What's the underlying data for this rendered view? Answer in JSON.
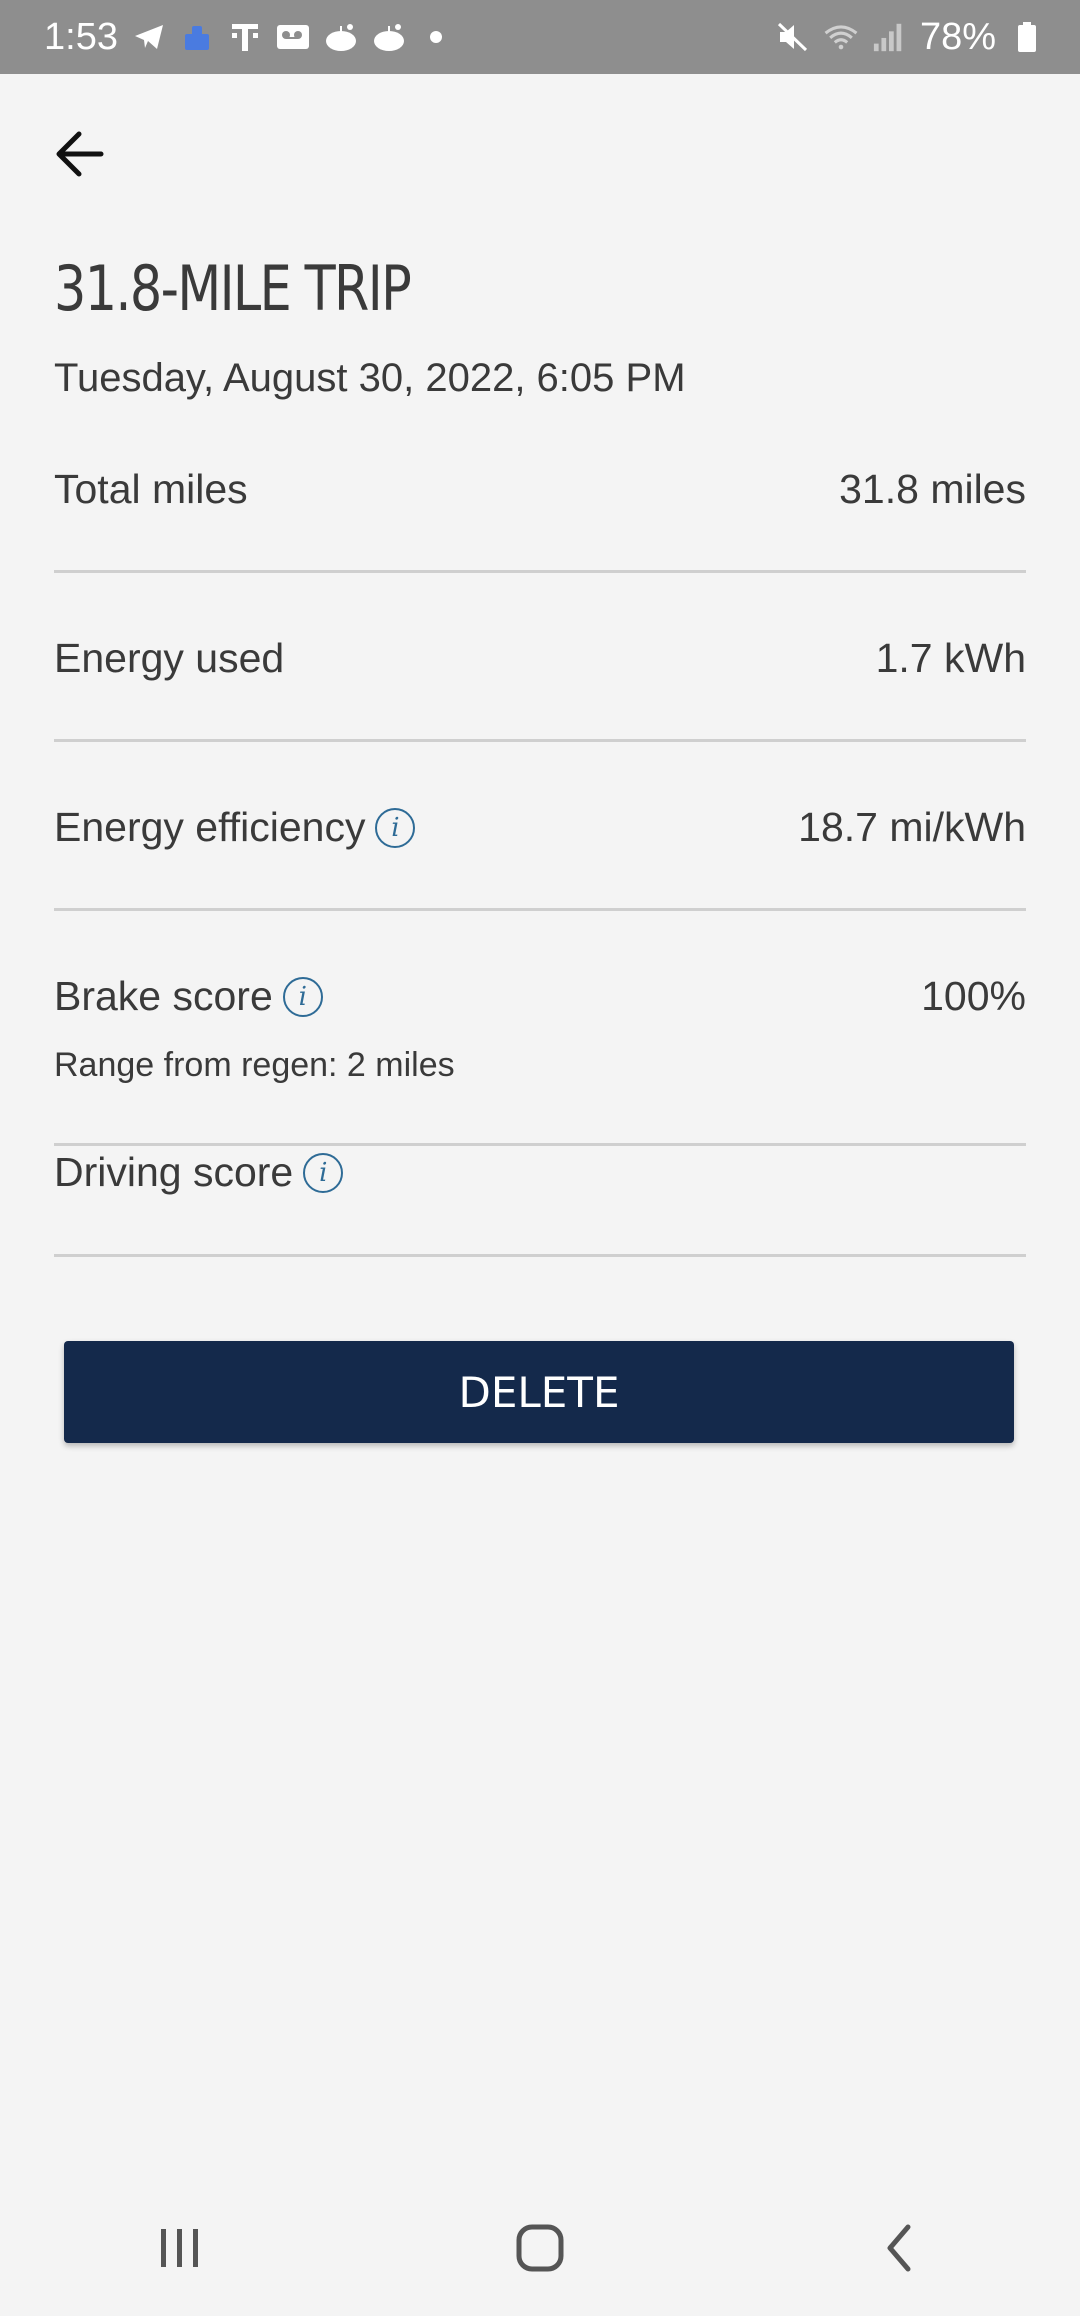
{
  "status_bar": {
    "time": "1:53",
    "battery": "78%",
    "left_icons": [
      "telegram-icon",
      "app-icon",
      "tmobile-icon",
      "voicemail-icon",
      "reddit-icon",
      "reddit-icon"
    ],
    "right_icons": [
      "mute-icon",
      "wifi-icon",
      "signal-icon",
      "battery-icon"
    ]
  },
  "header": {
    "title": "31.8-MILE TRIP",
    "date": "Tuesday, August 30, 2022, 6:05 PM"
  },
  "stats": [
    {
      "label": "Total miles",
      "value": "31.8 miles",
      "info": false
    },
    {
      "label": "Energy used",
      "value": "1.7 kWh",
      "info": false
    },
    {
      "label": "Energy efficiency",
      "value": "18.7 mi/kWh",
      "info": true
    },
    {
      "label": "Brake score",
      "value": "100%",
      "info": true,
      "note": "Range from regen: 2 miles"
    },
    {
      "label": "Driving score",
      "value": "",
      "info": true
    }
  ],
  "info_glyph": "i",
  "actions": {
    "delete_label": "DELETE"
  },
  "colors": {
    "accent": "#14294b",
    "info": "#2e6b96",
    "status_bar": "#8e8e8e"
  }
}
